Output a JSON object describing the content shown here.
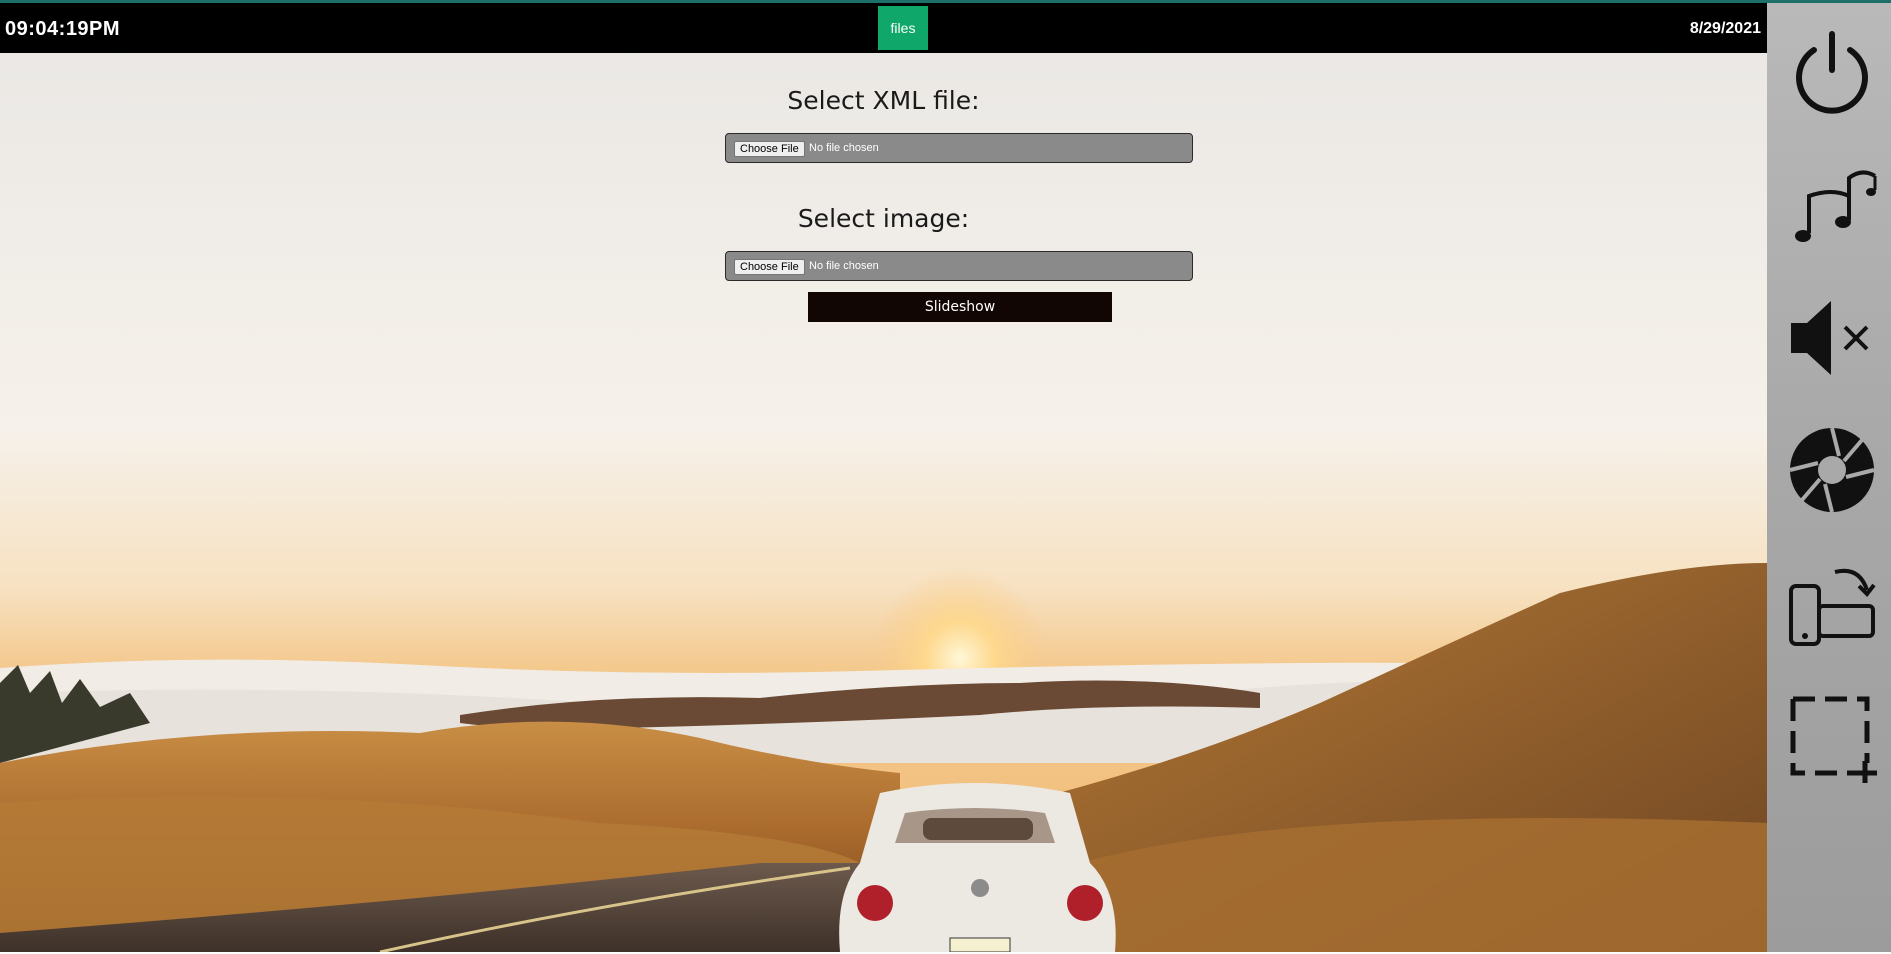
{
  "header": {
    "clock": "09:04:19PM",
    "date": "8/29/2021",
    "files_label": "files"
  },
  "form": {
    "xml_label": "Select XML file:",
    "xml_choose": "Choose File",
    "xml_status": "No file chosen",
    "image_label": "Select image:",
    "image_choose": "Choose File",
    "image_status": "No file chosen",
    "slideshow_label": "Slideshow"
  },
  "sidebar": {
    "icons": [
      "power-icon",
      "music-notes-icon",
      "speaker-mute-icon",
      "camera-shutter-icon",
      "rotate-device-icon",
      "crop-select-icon"
    ]
  },
  "colors": {
    "topbar": "#000000",
    "files_button": "#0fa86a",
    "slideshow_button": "#120604",
    "file_field": "#8a8a8a",
    "sidebar": "#a9a9a9",
    "top_accent": "#1d6f6a"
  }
}
